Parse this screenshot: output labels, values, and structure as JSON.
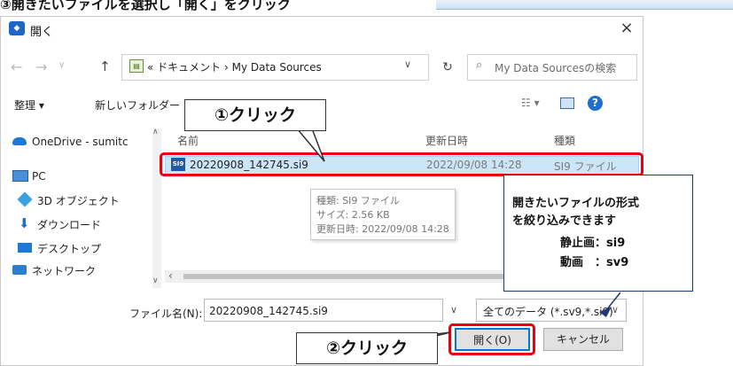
{
  "instruction_text": "③開きたいファイルを選択し「開く」をクリック",
  "dialog": {
    "title": "開く",
    "title_icon": "app-logo-icon",
    "close_label": "×"
  },
  "nav": {
    "back_label": "←",
    "forward_label": "→",
    "up_label": "↑",
    "recent_label": "∨",
    "address_path": "« ドキュメント › My Data Sources",
    "address_chevron": "∨",
    "refresh_label": "↻",
    "search_placeholder": "My Data Sourcesの検索"
  },
  "toolbar": {
    "organize_label": "整理 ▾",
    "new_folder_label": "新しいフォルダー",
    "view_label": "☷ ▾",
    "help_label": "?"
  },
  "sidebar": {
    "items": [
      {
        "label": "OneDrive - sumitc",
        "icon": "cloud-icon"
      },
      {
        "label": "PC",
        "icon": "computer-icon"
      },
      {
        "label": "3D オブジェクト",
        "icon": "cube-icon"
      },
      {
        "label": "ダウンロード",
        "icon": "download-arrow-icon"
      },
      {
        "label": "デスクトップ",
        "icon": "desktop-icon"
      },
      {
        "label": "ネットワーク",
        "icon": "network-icon"
      }
    ]
  },
  "list": {
    "columns": [
      "名前",
      "更新日時",
      "種類"
    ],
    "rows": [
      {
        "name": "20220908_142745.si9",
        "modified": "2022/09/08 14:28",
        "type": "SI9 ファイル"
      }
    ]
  },
  "tooltip": {
    "lines": [
      "種類: SI9 ファイル",
      "サイズ: 2.56 KB",
      "更新日時: 2022/09/08 14:28"
    ]
  },
  "bottom": {
    "filename_label": "ファイル名(N):",
    "filename_value": "20220908_142745.si9",
    "filetype_value": "全てのデータ (*.sv9,*.si9)",
    "open_label": "開く(O)",
    "cancel_label": "キャンセル"
  },
  "callouts": {
    "click1": "①クリック",
    "click2": "②クリック",
    "info_lines": [
      "開きたいファイルの形式",
      "を絞り込みできます",
      "静止画：si9",
      "動画　：sv9"
    ]
  },
  "colors": {
    "highlight_red": "#e60012",
    "selection_blue": "#cde6f7",
    "accent_blue": "#0078d7"
  }
}
